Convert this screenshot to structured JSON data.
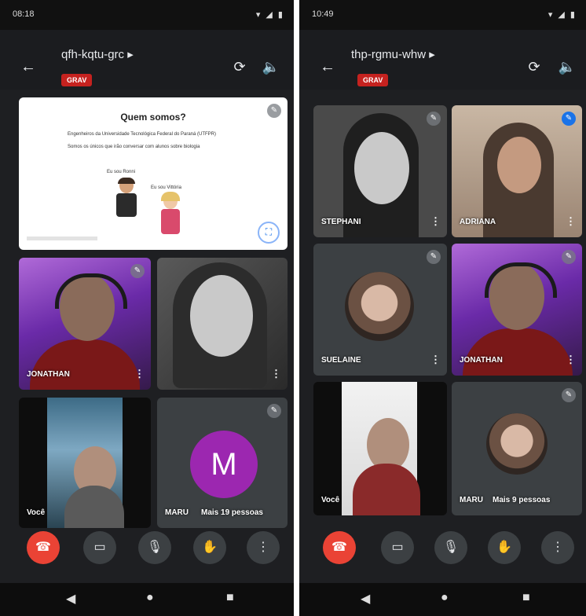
{
  "left": {
    "status_time": "08:18",
    "status_icons": "▾ ◢ ▮",
    "meeting_code": "qfh-kqtu-grc ▸",
    "recording_label": "GRAV",
    "slide": {
      "title": "Quem somos?",
      "bullets": [
        "Engenheiros da Universidade Tecnológica Federal do Paraná (UTFPR)",
        "Somos os únicos que irão conversar com alunos sobre biologia"
      ],
      "label_left": "Eu sou Ronni",
      "label_right": "Eu sou Vittória"
    },
    "tiles": [
      {
        "name": "JONATHAN"
      },
      {
        "name": ""
      },
      {
        "name": "Você"
      },
      {
        "name": "MARU",
        "extra": "Mais 19 pessoas",
        "avatar_letter": "M"
      }
    ]
  },
  "right": {
    "status_time": "10:49",
    "status_icons": "▾ ◢ ▮",
    "meeting_code": "thp-rgmu-whw ▸",
    "recording_label": "GRAV",
    "tiles": [
      {
        "name": "STEPHANI"
      },
      {
        "name": "ADRIANA"
      },
      {
        "name": "SUELAINE"
      },
      {
        "name": "JONATHAN"
      },
      {
        "name": "Você"
      },
      {
        "name": "MARU",
        "extra": "Mais 9 pessoas"
      }
    ]
  },
  "icons": {
    "back": "←",
    "camera_switch": "⟳",
    "speaker": "🔈",
    "pin": "✎",
    "more": "⋮",
    "end_call": "☎",
    "camera": "▭",
    "mic": "🎙",
    "hand": "✋",
    "options": "⋮",
    "nav_back": "◀",
    "nav_home": "●",
    "nav_recents": "■",
    "fullscreen": "⛶"
  }
}
